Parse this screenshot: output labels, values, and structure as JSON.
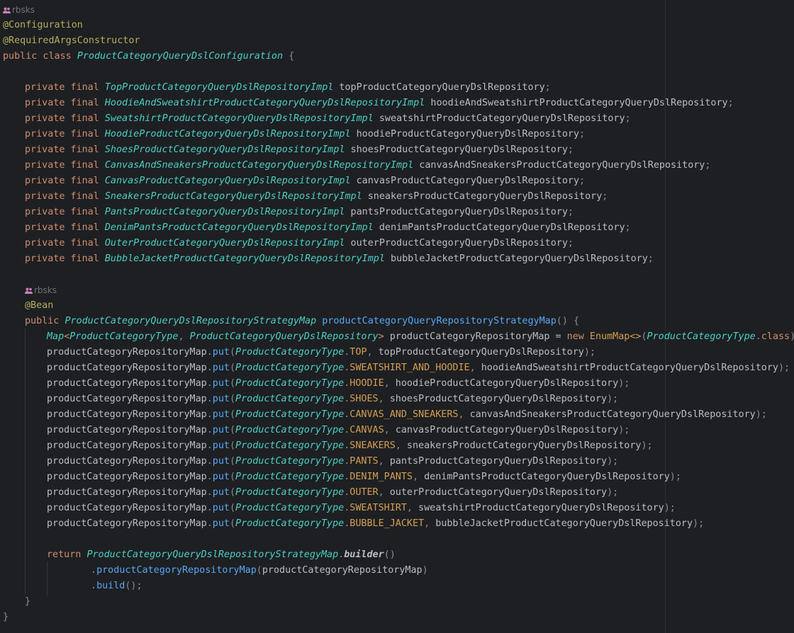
{
  "editor": {
    "author_hints": [
      "rbsks",
      "rbsks"
    ],
    "annotations": [
      "@Configuration",
      "@RequiredArgsConstructor",
      "@Bean"
    ],
    "class_decl": {
      "modifiers": "public class",
      "name": "ProductCategoryQueryDslConfiguration",
      "brace": "{"
    },
    "fields": [
      {
        "type": "TopProductCategoryQueryDslRepositoryImpl",
        "name": "topProductCategoryQueryDslRepository"
      },
      {
        "type": "HoodieAndSweatshirtProductCategoryQueryDslRepositoryImpl",
        "name": "hoodieAndSweatshirtProductCategoryQueryDslRepository"
      },
      {
        "type": "SweatshirtProductCategoryQueryDslRepositoryImpl",
        "name": "sweatshirtProductCategoryQueryDslRepository"
      },
      {
        "type": "HoodieProductCategoryQueryDslRepositoryImpl",
        "name": "hoodieProductCategoryQueryDslRepository"
      },
      {
        "type": "ShoesProductCategoryQueryDslRepositoryImpl",
        "name": "shoesProductCategoryQueryDslRepository"
      },
      {
        "type": "CanvasAndSneakersProductCategoryQueryDslRepositoryImpl",
        "name": "canvasAndSneakersProductCategoryQueryDslRepository"
      },
      {
        "type": "CanvasProductCategoryQueryDslRepositoryImpl",
        "name": "canvasProductCategoryQueryDslRepository"
      },
      {
        "type": "SneakersProductCategoryQueryDslRepositoryImpl",
        "name": "sneakersProductCategoryQueryDslRepository"
      },
      {
        "type": "PantsProductCategoryQueryDslRepositoryImpl",
        "name": "pantsProductCategoryQueryDslRepository"
      },
      {
        "type": "DenimPantsProductCategoryQueryDslRepositoryImpl",
        "name": "denimPantsProductCategoryQueryDslRepository"
      },
      {
        "type": "OuterProductCategoryQueryDslRepositoryImpl",
        "name": "outerProductCategoryQueryDslRepository"
      },
      {
        "type": "BubbleJacketProductCategoryQueryDslRepositoryImpl",
        "name": "bubbleJacketProductCategoryQueryDslRepository"
      }
    ],
    "field_modifiers": "private final",
    "method": {
      "modifier": "public",
      "return_type": "ProductCategoryQueryDslRepositoryStrategyMap",
      "name": "productCategoryQueryRepositoryStrategyMap",
      "params": "() {"
    },
    "map_decl": {
      "map": "Map",
      "key_type": "ProductCategoryType",
      "value_type": "ProductCategoryQueryDslRepository",
      "var": "productCategoryRepositoryMap",
      "new_kw": "new",
      "impl": "EnumMap<>",
      "arg_type": "ProductCategoryType",
      "class_kw": "class"
    },
    "map_var": "productCategoryRepositoryMap",
    "put_method": "put",
    "enum_type": "ProductCategoryType",
    "puts": [
      {
        "constant": "TOP",
        "repo": "topProductCategoryQueryDslRepository"
      },
      {
        "constant": "SWEATSHIRT_AND_HOODIE",
        "repo": "hoodieAndSweatshirtProductCategoryQueryDslRepository"
      },
      {
        "constant": "HOODIE",
        "repo": "hoodieProductCategoryQueryDslRepository"
      },
      {
        "constant": "SHOES",
        "repo": "shoesProductCategoryQueryDslRepository"
      },
      {
        "constant": "CANVAS_AND_SNEAKERS",
        "repo": "canvasAndSneakersProductCategoryQueryDslRepository"
      },
      {
        "constant": "CANVAS",
        "repo": "canvasProductCategoryQueryDslRepository"
      },
      {
        "constant": "SNEAKERS",
        "repo": "sneakersProductCategoryQueryDslRepository"
      },
      {
        "constant": "PANTS",
        "repo": "pantsProductCategoryQueryDslRepository"
      },
      {
        "constant": "DENIM_PANTS",
        "repo": "denimPantsProductCategoryQueryDslRepository"
      },
      {
        "constant": "OUTER",
        "repo": "outerProductCategoryQueryDslRepository"
      },
      {
        "constant": "SWEATSHIRT",
        "repo": "sweatshirtProductCategoryQueryDslRepository"
      },
      {
        "constant": "BUBBLE_JACKET",
        "repo": "bubbleJacketProductCategoryQueryDslRepository"
      }
    ],
    "return_stmt": {
      "keyword": "return",
      "type": "ProductCategoryQueryDslRepositoryStrategyMap",
      "builder": "builder",
      "chain_method": "productCategoryRepositoryMap",
      "chain_arg": "productCategoryRepositoryMap",
      "build": "build"
    },
    "closing_method_brace": "}",
    "closing_class_brace": "}"
  },
  "colors": {
    "background": "#1e1f22",
    "keyword": "#cf8e6d",
    "annotation": "#b3ae60",
    "class_name": "#4bd0c3",
    "method": "#56a8f5",
    "enum_constant": "#d39f55",
    "text": "#bcbec4"
  }
}
